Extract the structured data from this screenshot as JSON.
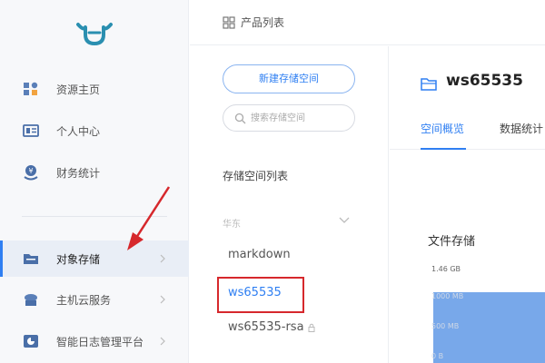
{
  "top": {
    "title": "产品列表",
    "grid_icon": "grid-icon"
  },
  "sidebar": {
    "items": [
      {
        "label": "资源主页",
        "icon": "dashboard-icon"
      },
      {
        "label": "个人中心",
        "icon": "id-card-icon"
      },
      {
        "label": "财务统计",
        "icon": "finance-icon"
      },
      {
        "label": "对象存储",
        "icon": "folder-icon",
        "active": true
      },
      {
        "label": "主机云服务",
        "icon": "cloud-host-icon"
      },
      {
        "label": "智能日志管理平台",
        "icon": "chart-icon"
      }
    ]
  },
  "storage": {
    "new_button": "新建存储空间",
    "search_placeholder": "搜索存储空间",
    "list_title": "存储空间列表",
    "region": "华东",
    "buckets": [
      "markdown",
      "ws65535",
      "ws65535-rsa"
    ],
    "selected": "ws65535"
  },
  "detail": {
    "title": "ws65535",
    "tabs": [
      "空间概览",
      "数据统计"
    ],
    "section_title": "文件存储",
    "y_ticks": [
      "1.46 GB",
      "1000 MB",
      "500 MB",
      "0 B"
    ]
  },
  "colors": {
    "accent": "#2f7ff2",
    "highlight_box": "#d6282c",
    "chart_fill": "#78a8ea"
  }
}
